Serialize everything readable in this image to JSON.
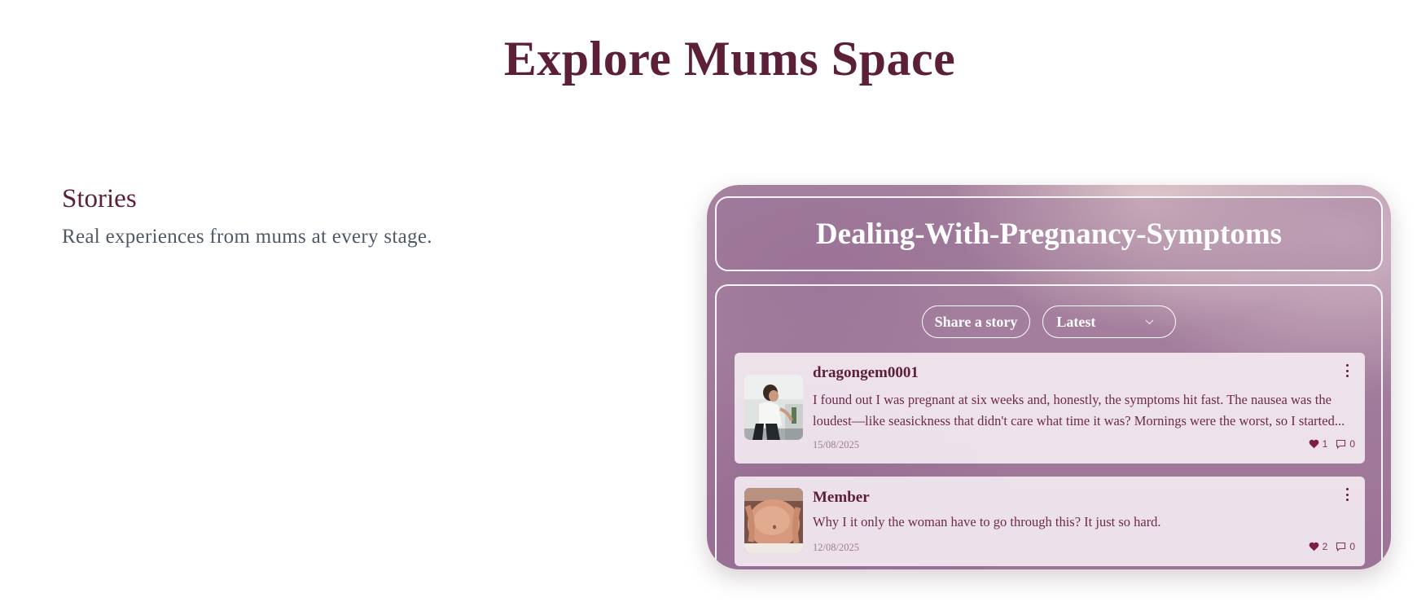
{
  "page": {
    "title": "Explore Mums Space"
  },
  "intro": {
    "heading": "Stories",
    "text": "Real experiences from mums at every stage."
  },
  "panel": {
    "title": "Dealing-With-Pregnancy-Symptoms",
    "share_button": "Share a story",
    "sort": {
      "selected": "Latest"
    }
  },
  "posts": [
    {
      "author": "dragongem0001",
      "text": "I found out I was pregnant at six weeks and, honestly, the symptoms hit fast. The nausea was the loudest—like seasickness that didn't care what time it was? Mornings were the worst, so I started...",
      "date": "15/08/2025",
      "likes": "1",
      "comments": "0"
    },
    {
      "author": "Member",
      "text": "Why I it only the woman have to go through this? It just so hard.",
      "date": "12/08/2025",
      "likes": "2",
      "comments": "0"
    }
  ],
  "colors": {
    "brand": "#5b1f38",
    "panel_purple": "#a37d9c",
    "card_bg": "#f5ecf3"
  },
  "icons": {
    "like": "heart-icon",
    "comment": "comment-icon",
    "menu": "more-vertical-icon",
    "dropdown": "chevron-down-icon"
  }
}
